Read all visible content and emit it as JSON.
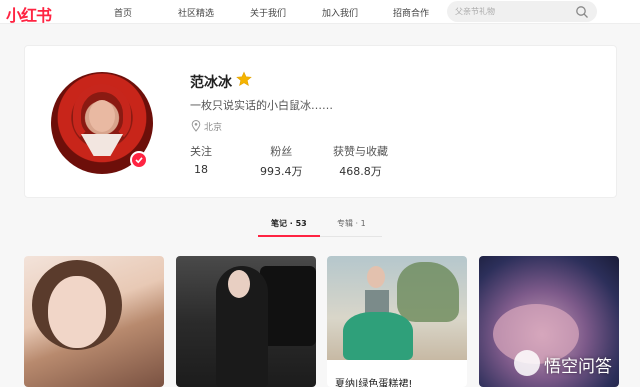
{
  "header": {
    "logo": "小红书",
    "nav": [
      "首页",
      "社区精选",
      "关于我们",
      "加入我们",
      "招商合作"
    ],
    "search_placeholder": "父亲节礼物"
  },
  "profile": {
    "name": "范冰冰",
    "bio": "一枚只说实话的小白鼠冰……",
    "location": "北京",
    "stats": [
      {
        "label": "关注",
        "value": "18"
      },
      {
        "label": "粉丝",
        "value": "993.4万"
      },
      {
        "label": "获赞与收藏",
        "value": "468.8万"
      }
    ]
  },
  "tabs": [
    {
      "label": "笔记 · 53",
      "active": true
    },
    {
      "label": "专辑 · 1",
      "active": false
    }
  ],
  "cards": [
    {
      "title": ""
    },
    {
      "title": ""
    },
    {
      "title": "夏纳|绿色蛋糕裙!"
    },
    {
      "title": ""
    }
  ],
  "watermark": {
    "text": "悟空问答"
  },
  "colors": {
    "accent": "#ff2442",
    "verified_star": "#f5b400"
  }
}
